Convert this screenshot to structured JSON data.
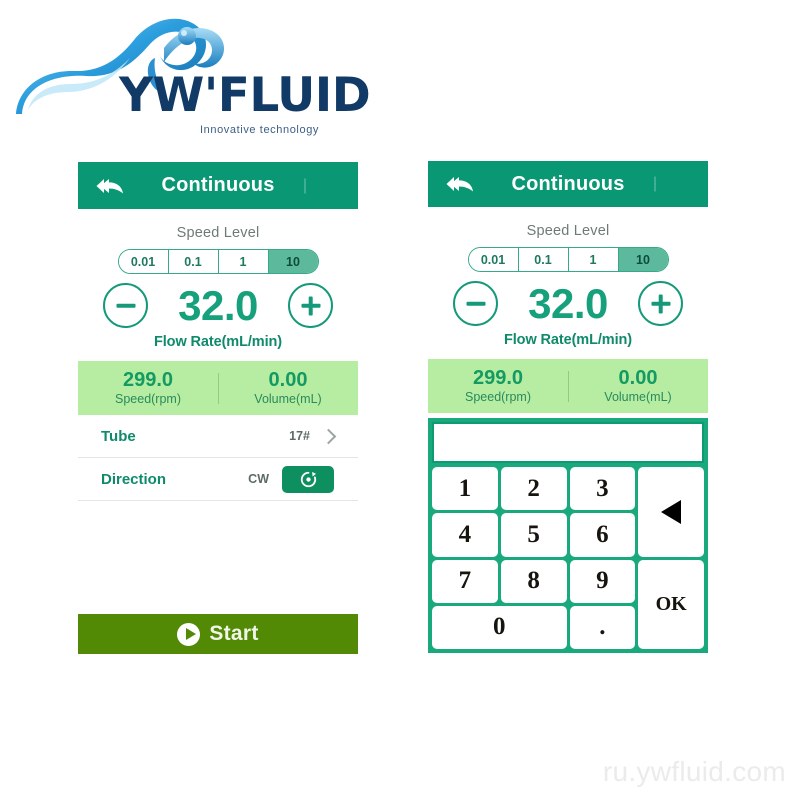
{
  "brand": {
    "wordmark": "YW'FLUID",
    "tagline": "Innovative technology",
    "logo_icon": "water-splash-icon",
    "colors": {
      "text": "#123a66",
      "splash": "#1b7fc4"
    }
  },
  "watermark": {
    "text": "ru.ywfluid.com"
  },
  "theme": {
    "header_green": "#0a9874",
    "accent_green": "#17a07c",
    "readout_band": "#b6eda2",
    "start_olive": "#528a06",
    "keypad_green": "#1aa87d",
    "segment_active": "#5cb99c"
  },
  "panels": [
    {
      "id": "left",
      "header": {
        "title": "Continuous",
        "back_icon": "double-chevron-back-icon",
        "menu_icon": "menu-divider-icon"
      },
      "speed_level": {
        "label": "Speed Level",
        "options": [
          "0.01",
          "0.1",
          "1",
          "10"
        ],
        "selected": "10"
      },
      "flow": {
        "minus_icon": "minus-circle-icon",
        "plus_icon": "plus-circle-icon",
        "value": "32.0",
        "caption": "Flow Rate(mL/min)"
      },
      "readout": {
        "speed_value": "299.0",
        "speed_label": "Speed(rpm)",
        "volume_value": "0.00",
        "volume_label": "Volume(mL)"
      },
      "rows": [
        {
          "label": "Tube",
          "value": "17#",
          "control": "chevron-right-icon"
        },
        {
          "label": "Direction",
          "value": "CW",
          "control": "rotate-cw-icon"
        }
      ],
      "start": {
        "label": "Start",
        "icon": "play-circle-icon"
      }
    },
    {
      "id": "right",
      "header": {
        "title": "Continuous",
        "back_icon": "double-chevron-back-icon",
        "menu_icon": "menu-divider-icon"
      },
      "speed_level": {
        "label": "Speed Level",
        "options": [
          "0.01",
          "0.1",
          "1",
          "10"
        ],
        "selected": "10"
      },
      "flow": {
        "minus_icon": "minus-circle-icon",
        "plus_icon": "plus-circle-icon",
        "value": "32.0",
        "caption": "Flow Rate(mL/min)"
      },
      "readout": {
        "speed_value": "299.0",
        "speed_label": "Speed(rpm)",
        "volume_value": "0.00",
        "volume_label": "Volume(mL)"
      },
      "keypad": {
        "display_value": "",
        "keys": [
          "1",
          "2",
          "3",
          "4",
          "5",
          "6",
          "7",
          "8",
          "9"
        ],
        "zero": "0",
        "decimal": ".",
        "backspace_icon": "backspace-triangle-icon",
        "ok": "OK"
      }
    }
  ]
}
